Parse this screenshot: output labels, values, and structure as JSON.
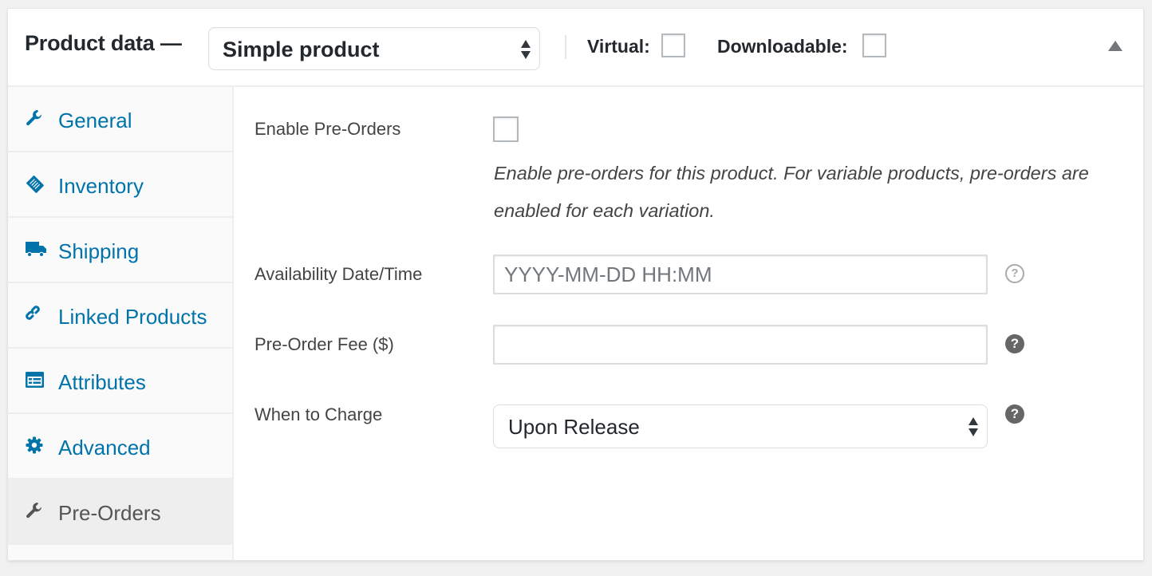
{
  "header": {
    "title": "Product data —",
    "product_type": "Simple product",
    "virtual_label": "Virtual:",
    "virtual_checked": false,
    "downloadable_label": "Downloadable:",
    "downloadable_checked": false
  },
  "tabs": [
    {
      "label": "General",
      "icon": "wrench-icon"
    },
    {
      "label": "Inventory",
      "icon": "clipboard-tag-icon"
    },
    {
      "label": "Shipping",
      "icon": "truck-icon"
    },
    {
      "label": "Linked Products",
      "icon": "link-icon"
    },
    {
      "label": "Attributes",
      "icon": "list-table-icon"
    },
    {
      "label": "Advanced",
      "icon": "gear-icon"
    },
    {
      "label": "Pre-Orders",
      "icon": "wrench-icon",
      "active": true
    }
  ],
  "preorders": {
    "enable_label": "Enable Pre-Orders",
    "enable_checked": false,
    "enable_description": "Enable pre-orders for this product. For variable products, pre-orders are enabled for each variation.",
    "availability_label": "Availability Date/Time",
    "availability_value": "",
    "availability_placeholder": "YYYY-MM-DD HH:MM",
    "fee_label": "Pre-Order Fee ($)",
    "fee_value": "",
    "charge_label": "When to Charge",
    "charge_value": "Upon Release",
    "help_glyph": "?"
  },
  "colors": {
    "link": "#0073aa",
    "active_tab_text": "#555555",
    "panel_bg": "#ffffff",
    "page_bg": "#f1f1f1"
  }
}
